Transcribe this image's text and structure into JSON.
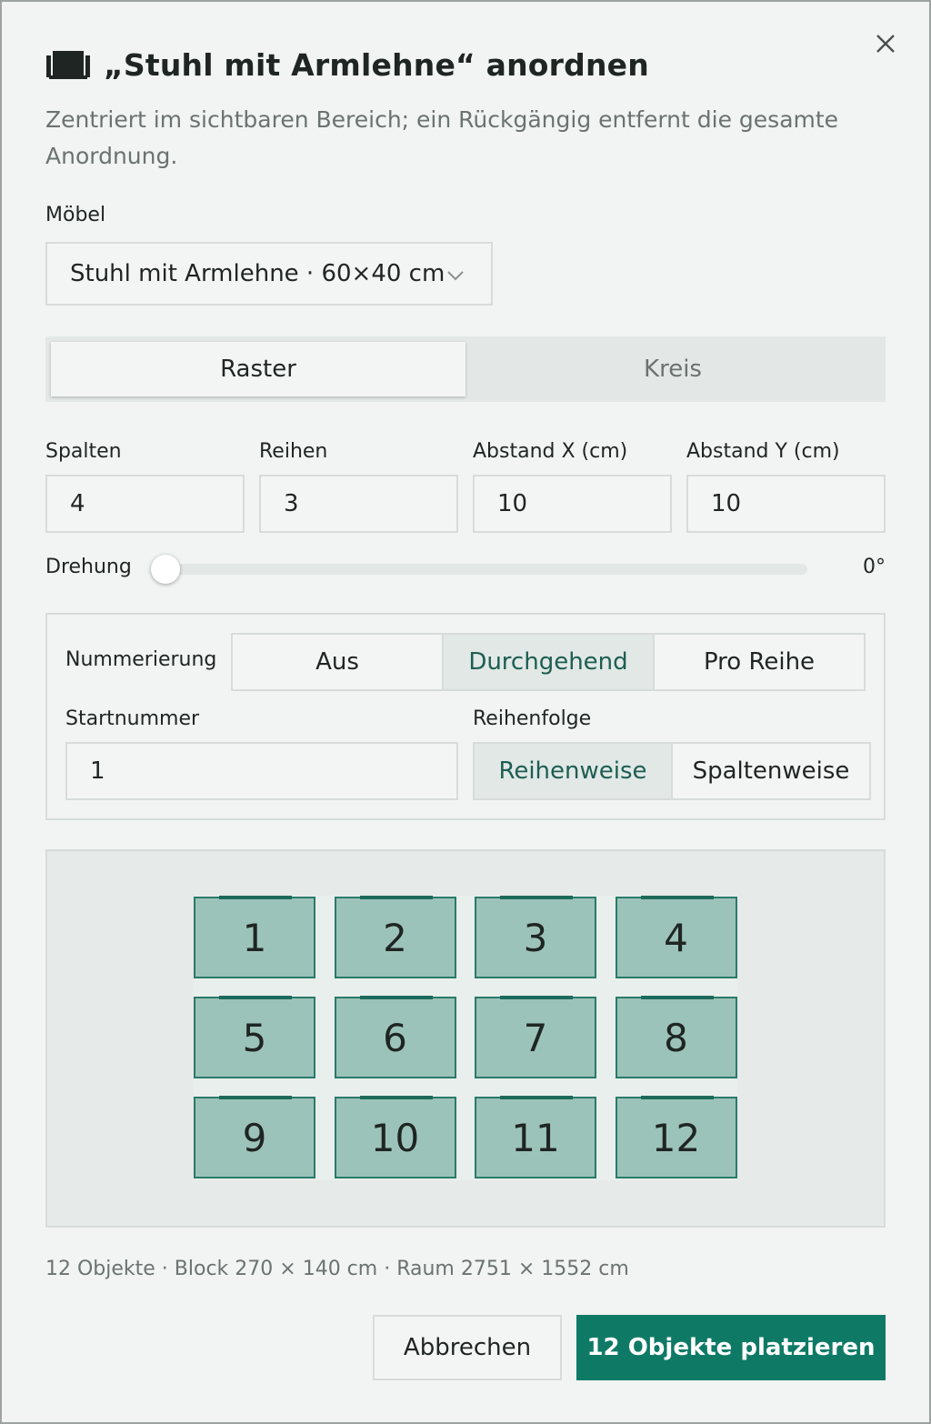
{
  "dialog": {
    "title": "„Stuhl mit Armlehne“ anordnen",
    "subtitle": "Zentriert im sichtbaren Bereich; ein Rückgängig entfernt die gesamte Anordnung.",
    "title_icon": "furniture-icon",
    "close_icon": "close-icon"
  },
  "furniture": {
    "label": "Möbel",
    "selected": "Stuhl mit Armlehne · 60×40 cm"
  },
  "layout_mode": {
    "options": [
      "Raster",
      "Kreis"
    ],
    "active": "Raster"
  },
  "grid": {
    "columns_label": "Spalten",
    "columns": "4",
    "rows_label": "Reihen",
    "rows": "3",
    "gap_x_label": "Abstand X (cm)",
    "gap_x": "10",
    "gap_y_label": "Abstand Y (cm)",
    "gap_y": "10"
  },
  "rotation": {
    "label": "Drehung",
    "value_text": "0°",
    "value_deg": 0
  },
  "numbering": {
    "label": "Nummerierung",
    "options": [
      "Aus",
      "Durchgehend",
      "Pro Reihe"
    ],
    "active": "Durchgehend",
    "start_label": "Startnummer",
    "start_value": "1",
    "order_label": "Reihenfolge",
    "order_options": [
      "Reihenweise",
      "Spaltenweise"
    ],
    "order_active": "Reihenweise"
  },
  "preview": {
    "items": [
      "1",
      "2",
      "3",
      "4",
      "5",
      "6",
      "7",
      "8",
      "9",
      "10",
      "11",
      "12"
    ]
  },
  "summary": "12 Objekte · Block 270 × 140 cm · Raum 2751 × 1552 cm",
  "actions": {
    "cancel": "Abbrechen",
    "confirm": "12 Objekte platzieren"
  },
  "colors": {
    "accent": "#0e7a66",
    "chair_fill": "#9cc3b9",
    "chair_border": "#2a7a6a"
  }
}
